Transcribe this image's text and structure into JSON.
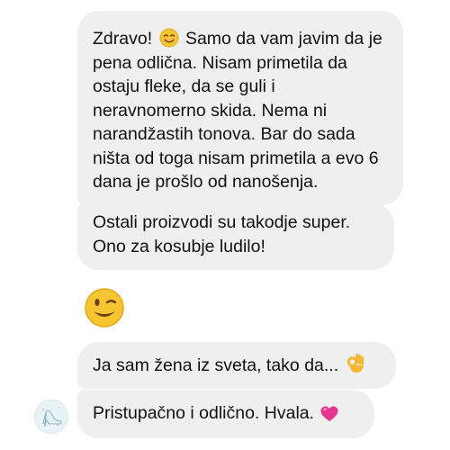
{
  "messages": [
    {
      "text_before_emoji": "Zdravo! ",
      "emoji": "smiling-face-icon",
      "text_after_emoji": " Samo da vam javim da je pena odlična. Nisam primetila da ostaju fleke, da se guli i neravnomerno skida. Nema ni narandžastih tonova. Bar do sada ništa od toga nisam primetila a evo 6 dana je prošlo od nanošenja."
    },
    {
      "text": "Ostali proizvodi su takodje super.\nOno za kosubje ludilo!"
    },
    {
      "emoji_only": "winking-face-icon"
    },
    {
      "text": "Ja sam žena iz sveta, tako da... ",
      "emoji": "ok-hand-icon"
    },
    {
      "text": "Pristupačno i odlično. Hvala. ",
      "emoji": "pink-heart-icon"
    }
  ],
  "sender_avatar": "high-heel-shoe-avatar",
  "colors": {
    "bubble_bg": "#efefef",
    "text": "#111111",
    "emoji_yellow": "#f7c531",
    "heart_pink": "#e5358f"
  }
}
